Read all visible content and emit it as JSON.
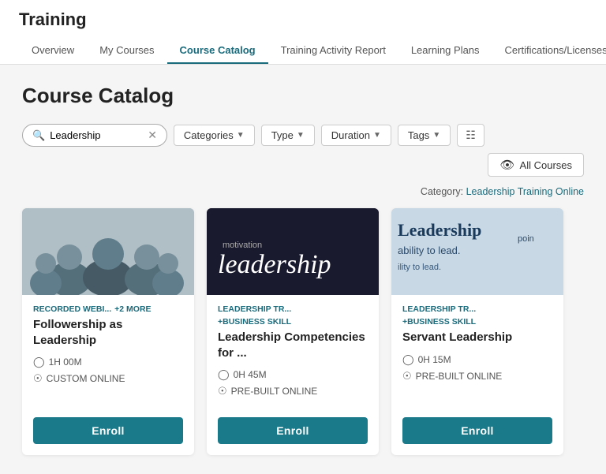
{
  "app": {
    "title": "Training"
  },
  "nav": {
    "tabs": [
      {
        "id": "overview",
        "label": "Overview",
        "active": false
      },
      {
        "id": "my-courses",
        "label": "My Courses",
        "active": false
      },
      {
        "id": "course-catalog",
        "label": "Course Catalog",
        "active": true
      },
      {
        "id": "training-activity",
        "label": "Training Activity Report",
        "active": false
      },
      {
        "id": "learning-plans",
        "label": "Learning Plans",
        "active": false
      },
      {
        "id": "certifications",
        "label": "Certifications/Licenses",
        "active": false
      }
    ]
  },
  "page": {
    "title": "Course Catalog"
  },
  "filters": {
    "search_value": "Leadership",
    "search_placeholder": "Leadership",
    "categories_label": "Categories",
    "type_label": "Type",
    "duration_label": "Duration",
    "tags_label": "Tags",
    "all_courses_label": "All Courses"
  },
  "category_info": "Category: Leadership Training Online",
  "cards": [
    {
      "id": "card-1",
      "tags": [
        "RECORDED WEBI...",
        "+2 MORE"
      ],
      "title": "Followership as Leadership",
      "duration": "1H 00M",
      "delivery": "CUSTOM ONLINE",
      "img_type": "people"
    },
    {
      "id": "card-2",
      "tags": [
        "LEADERSHIP TR...",
        "+BUSINESS SKILL"
      ],
      "title": "Leadership Competencies for ...",
      "duration": "0H 45M",
      "delivery": "PRE-BUILT ONLINE",
      "img_type": "leadership"
    },
    {
      "id": "card-3",
      "tags": [
        "LEADERSHIP TR...",
        "+BUSINESS SKILL"
      ],
      "title": "Servant Leadership",
      "duration": "0H 15M",
      "delivery": "PRE-BUILT ONLINE",
      "img_type": "servant"
    }
  ],
  "enroll_label": "Enroll"
}
